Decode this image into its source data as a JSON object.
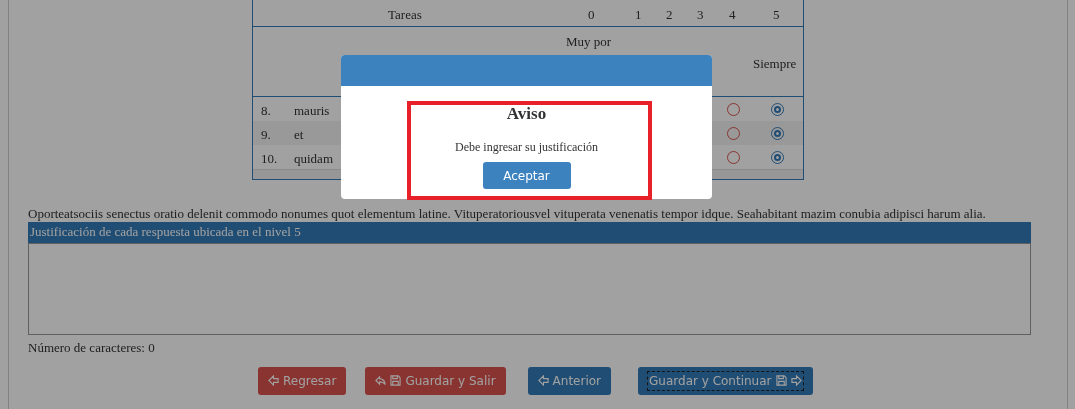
{
  "table": {
    "header_levels": [
      "0",
      "1",
      "2",
      "3",
      "4",
      "5"
    ],
    "task_header": "Tareas",
    "low_label": "Muy por",
    "high_label": "Siempre",
    "rows": [
      {
        "number": "8.",
        "task": "mauris",
        "options": [
          {
            "selected": false
          },
          {
            "selected": true
          }
        ]
      },
      {
        "number": "9.",
        "task": "et",
        "options": [
          {
            "selected": false
          },
          {
            "selected": true
          }
        ]
      },
      {
        "number": "10.",
        "task": "quidam",
        "options": [
          {
            "selected": false
          },
          {
            "selected": true
          }
        ]
      }
    ]
  },
  "paragraph": "Oporteatsociis senectus oratio delenit commodo nonumes quot elementum latine. Vituperatoriousvel vituperata venenatis tempor idque. Seahabitant mazim conubia adipisci harum alia.",
  "justification": {
    "label": "Justificación de cada respuesta ubicada en el nivel 5"
  },
  "char_count": "Número de caracteres: 0",
  "buttons": [
    {
      "label": "Regresar",
      "kind": "back",
      "focused": false
    },
    {
      "label": "Guardar y Salir",
      "kind": "save_exit",
      "focused": false
    },
    {
      "label": "Anterior",
      "kind": "previous",
      "focused": false
    },
    {
      "label": "Guardar y Continuar",
      "kind": "save_next",
      "focused": true
    }
  ],
  "modal": {
    "title": "Aviso",
    "message": "Debe ingresar su justificación",
    "button": "Aceptar",
    "highlighted": true
  }
}
